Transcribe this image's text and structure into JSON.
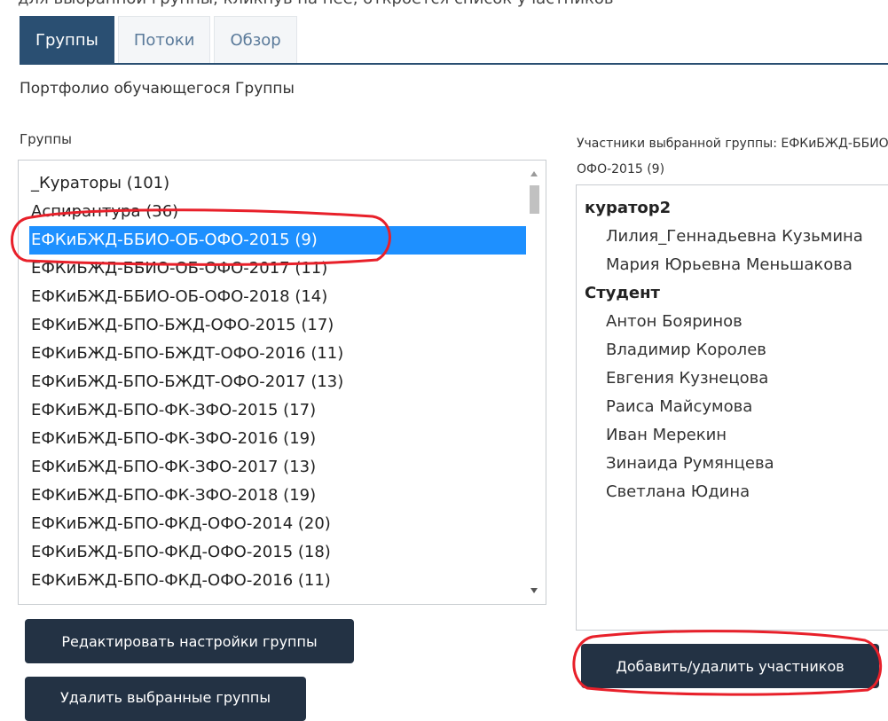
{
  "top_text": "для выбранной группы, кликнув на неё, откроется список участников",
  "tabs": [
    {
      "label": "Группы",
      "active": true
    },
    {
      "label": "Потоки",
      "active": false
    },
    {
      "label": "Обзор",
      "active": false
    }
  ],
  "page_title": "Портфолио обучающегося Группы",
  "groups_label": "Группы",
  "groups": [
    "_Кураторы (101)",
    "Аспирантура (36)",
    "ЕФКиБЖД-ББИО-ОБ-ОФО-2015 (9)",
    "ЕФКиБЖД-ББИО-ОБ-ОФО-2017 (11)",
    "ЕФКиБЖД-ББИО-ОБ-ОФО-2018 (14)",
    "ЕФКиБЖД-БПО-БЖД-ОФО-2015 (17)",
    "ЕФКиБЖД-БПО-БЖДТ-ОФО-2016 (11)",
    "ЕФКиБЖД-БПО-БЖДТ-ОФО-2017 (13)",
    "ЕФКиБЖД-БПО-ФК-ЗФО-2015 (17)",
    "ЕФКиБЖД-БПО-ФК-ЗФО-2016 (19)",
    "ЕФКиБЖД-БПО-ФК-ЗФО-2017 (13)",
    "ЕФКиБЖД-БПО-ФК-ЗФО-2018 (19)",
    "ЕФКиБЖД-БПО-ФКД-ОФО-2014 (20)",
    "ЕФКиБЖД-БПО-ФКД-ОФО-2015 (18)",
    "ЕФКиБЖД-БПО-ФКД-ОФО-2016 (11)"
  ],
  "selected_group": "ЕФКиБЖД-ББИО-ОБ-ОФО-2015 (9)",
  "members_label_line1": "Участники выбранной группы: ЕФКиБЖД-ББИО-ОБ-",
  "members_label_line2": "ОФО-2015 (9)",
  "members": {
    "roles": [
      {
        "role": "куратор2",
        "names": [
          "Лилия_Геннадьевна Кузьмина",
          "Мария Юрьевна Меньшакова"
        ]
      },
      {
        "role": "Студент",
        "names": [
          "Антон Бояринов",
          "Владимир Королев",
          "Евгения Кузнецова",
          "Раиса Майсумова",
          "Иван Мерекин",
          "Зинаида Румянцева",
          "Светлана Юдина"
        ]
      }
    ]
  },
  "buttons": {
    "edit": "Редактировать настройки группы",
    "delete": "Удалить выбранные группы",
    "add_remove": "Добавить/удалить участников"
  },
  "colors": {
    "tab_active": "#2a4f72",
    "selection": "#1e90ff",
    "button_bg": "#233244",
    "annotation": "#e8202a"
  }
}
